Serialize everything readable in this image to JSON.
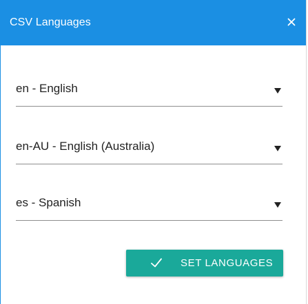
{
  "dialog": {
    "title": "CSV Languages",
    "close_icon": "close-icon",
    "close_glyph": "×"
  },
  "colors": {
    "header": "#1b8fe3",
    "button": "#1aa99a",
    "underline": "#8d8d8d"
  },
  "languages": [
    {
      "value": "en - English",
      "icon": "dropdown-arrow-icon"
    },
    {
      "value": "en-AU - English (Australia)",
      "icon": "dropdown-arrow-icon"
    },
    {
      "value": "es - Spanish",
      "icon": "dropdown-arrow-icon"
    }
  ],
  "submit": {
    "label": "SET LANGUAGES",
    "icon": "check-icon"
  }
}
